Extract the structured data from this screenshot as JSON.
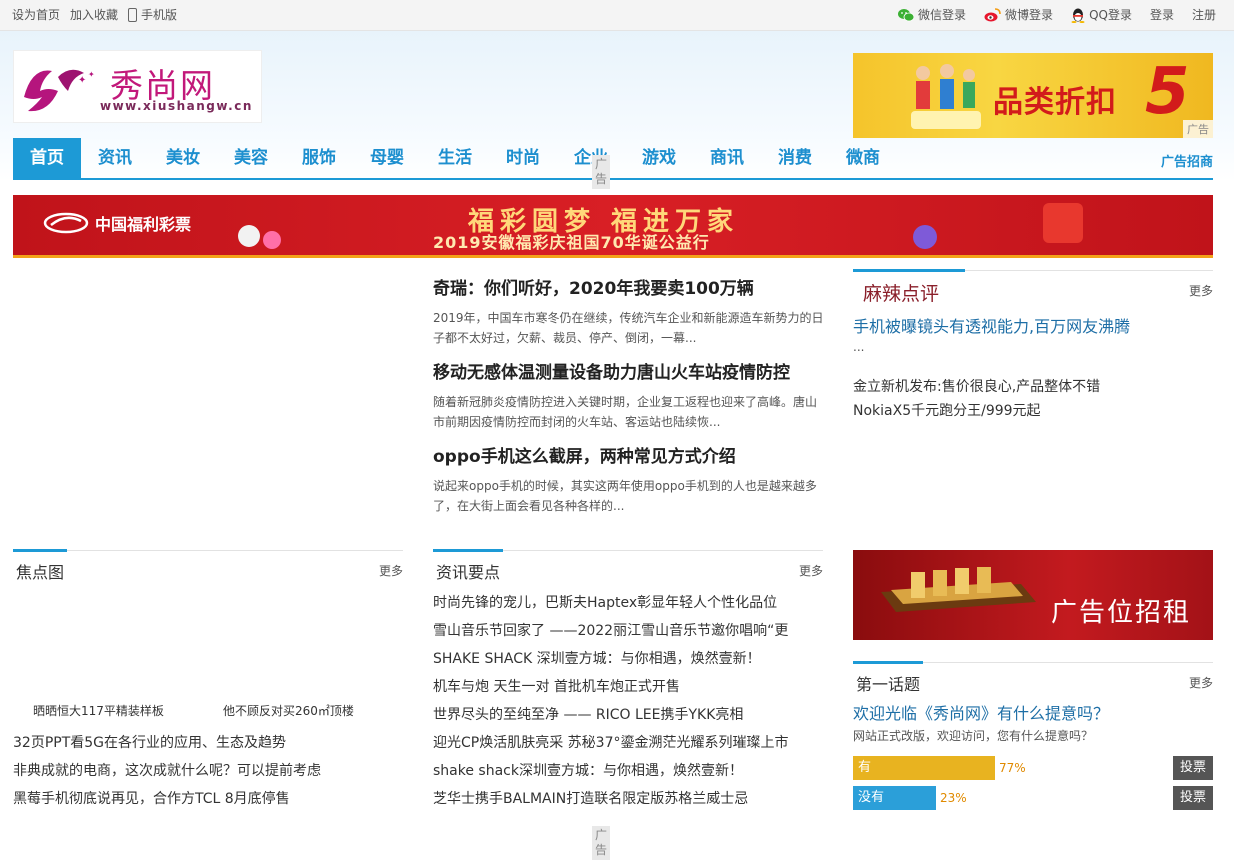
{
  "topbar": {
    "left": [
      "设为首页",
      "加入收藏",
      "手机版"
    ],
    "right": [
      "微信登录",
      "微博登录",
      "QQ登录",
      "登录",
      "注册"
    ]
  },
  "logo": {
    "name": "秀尚网",
    "url": "www.xiushangw.cn"
  },
  "top_ad": {
    "slogan": "品类折扣",
    "number": "5",
    "tag": "广告",
    "colors": {
      "bg": "#f5c42b",
      "text": "#d21b1b"
    }
  },
  "nav": {
    "items": [
      "首页",
      "资讯",
      "美妆",
      "美容",
      "服饰",
      "母婴",
      "生活",
      "时尚",
      "企业",
      "游戏",
      "商讯",
      "消费",
      "微商"
    ],
    "active": "首页",
    "ad_link": "广告招商",
    "float_tag": "广告"
  },
  "banner": {
    "logo_text": "中国福利彩票",
    "line1": "福彩圆梦 福进万家",
    "line2": "2019安徽福彩庆祖国70华诞公益行"
  },
  "news": [
    {
      "title": "奇瑞：你们听好，2020年我要卖100万辆",
      "summary": "2019年，中国车市寒冬仍在继续，传统汽车企业和新能源造车新势力的日子都不太好过，欠薪、裁员、停产、倒闭，一幕..."
    },
    {
      "title": "移动无感体温测量设备助力唐山火车站疫情防控",
      "summary": "随着新冠肺炎疫情防控进入关键时期，企业复工返程也迎来了高峰。唐山市前期因疫情防控而封闭的火车站、客运站也陆续恢..."
    },
    {
      "title": "oppo手机这么截屏，两种常见方式介绍",
      "summary": "说起来oppo手机的时候，其实这两年使用oppo手机到的人也是越来越多了，在大街上面会看见各种各样的..."
    }
  ],
  "review": {
    "title": "麻辣点评",
    "more": "更多",
    "headline": "手机被曝镜头有透视能力,百万网友沸腾",
    "ellipsis": "...",
    "links": [
      "金立新机发布:售价很良心,产品整体不错",
      "NokiaX5千元跑分王/999元起"
    ]
  },
  "focus": {
    "title": "焦点图",
    "more": "更多",
    "captions": [
      "晒晒恒大117平精装样板",
      "他不顾反对买260㎡顶楼"
    ],
    "links": [
      "32页PPT看5G在各行业的应用、生态及趋势",
      "非典成就的电商，这次成就什么呢？可以提前考虑",
      "黑莓手机彻底说再见，合作方TCL 8月底停售"
    ]
  },
  "info": {
    "title": "资讯要点",
    "more": "更多",
    "links": [
      "时尚先锋的宠儿，巴斯夫Haptex彰显年轻人个性化品位",
      "雪山音乐节回家了 ——2022丽江雪山音乐节邀你唱响“更",
      "SHAKE SHACK 深圳壹方城：与你相遇，焕然壹新！",
      "机车与炮 天生一对 首批机车炮正式开售",
      "世界尽头的至纯至净 —— RICO LEE携手YKK亮相",
      "迎光CP焕活肌肤亮采 苏秘37°鎏金溯茫光耀系列璀璨上市",
      "shake shack深圳壹方城：与你相遇，焕然壹新！",
      "芝华士携手BALMAIN打造联名限定版苏格兰威士忌"
    ]
  },
  "rent_ad": {
    "text": "广告位招租"
  },
  "poll": {
    "title": "第一话题",
    "more": "更多",
    "question": "欢迎光临《秀尚网》有什么提意吗？",
    "desc": "网站正式改版，欢迎访问，您有什么提意吗？",
    "options": [
      {
        "label": "有",
        "percent": 77,
        "pct_text": "77%",
        "color": "#e8b320",
        "vote": "投票"
      },
      {
        "label": "没有",
        "percent": 23,
        "pct_text": "23%",
        "color": "#2b9fd9",
        "vote": "投票"
      }
    ]
  },
  "bottom_tag": "广告"
}
